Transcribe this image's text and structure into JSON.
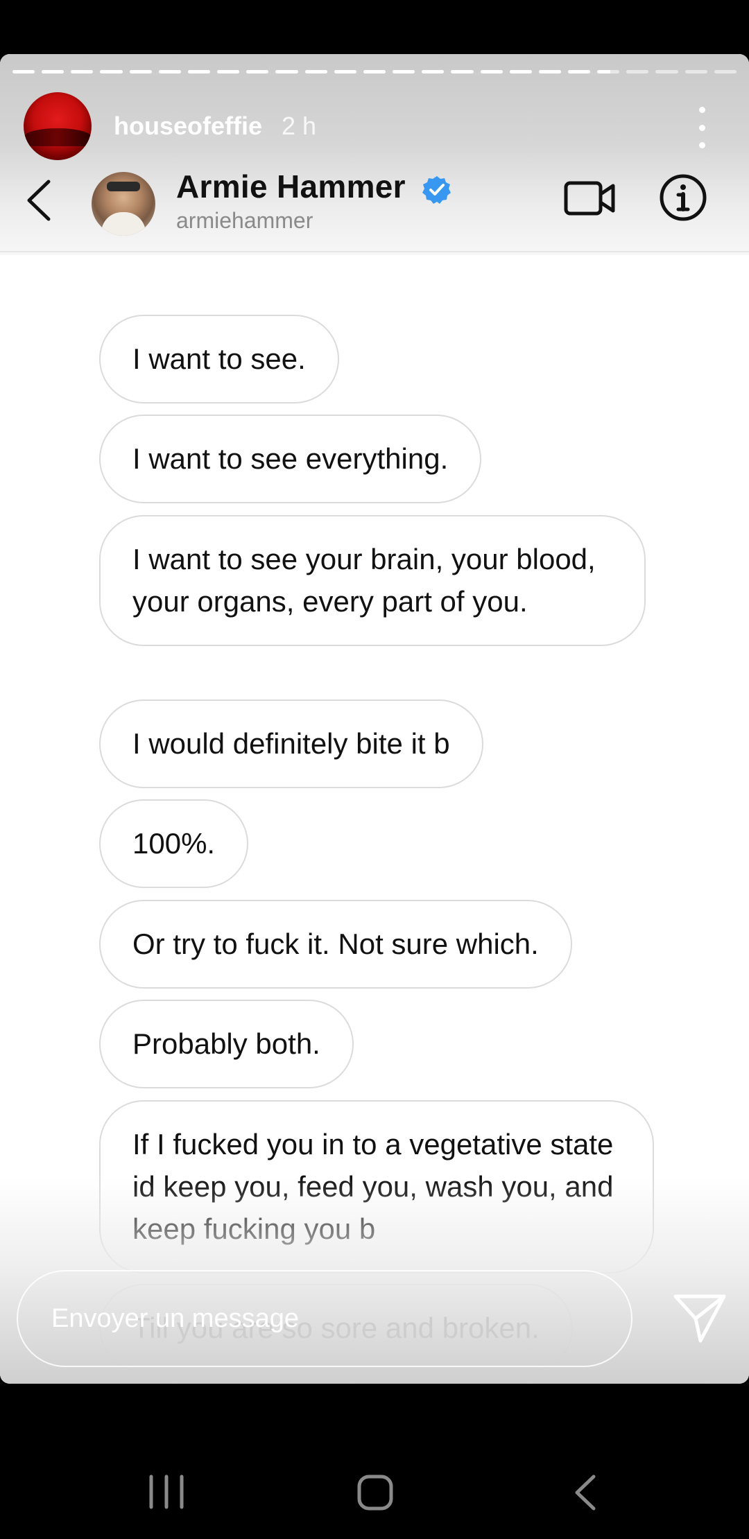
{
  "story": {
    "username": "houseofeffie",
    "time_ago": "2 h",
    "progress": {
      "segments": 25,
      "completed": 20,
      "current_fill": 0.6
    }
  },
  "dm": {
    "name": "Armie Hammer",
    "handle": "armiehammer",
    "verified": true
  },
  "messages": [
    "I want to see.",
    "I want to see everything.",
    "I want to see your brain, your blood, your organs, every part of you.",
    "I would definitely bite it b",
    "100%.",
    "Or try to fuck it. Not sure which.",
    "Probably both.",
    "If I fucked you in to a vegetative state id keep you, feed you, wash you, and keep fucking you b",
    "Till you are so sore and broken."
  ],
  "reply": {
    "placeholder": "Envoyer un message"
  },
  "icons": {
    "back": "chevron-left-icon",
    "verified": "verified-badge-icon",
    "video": "video-camera-icon",
    "info": "info-icon",
    "send": "paper-plane-icon",
    "menu": "more-vertical-icon"
  },
  "colors": {
    "verified": "#3897f0",
    "text": "#111111",
    "bubble_border": "#dbdbdb",
    "handle": "#8a8a8a"
  }
}
